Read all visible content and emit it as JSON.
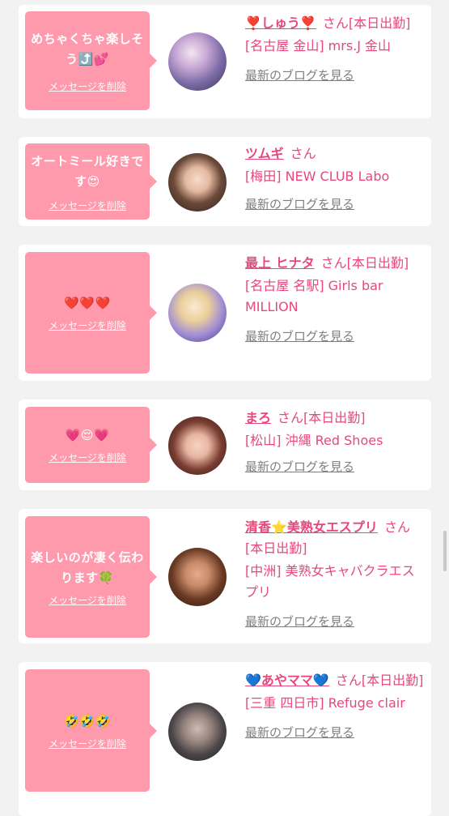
{
  "items": [
    {
      "message": "めちゃくちゃ楽しそう⤴️💕",
      "delete_label": "メッセージを削除",
      "name": "❣️しゅう❣️",
      "san": "さん[本日出勤]",
      "shop": "[名古屋 金山] mrs.J 金山",
      "blog": "最新のブログを見る",
      "avatar_colors": [
        "#7a6aa6",
        "#d9c3d6"
      ]
    },
    {
      "message": "オートミール好きです😍",
      "delete_label": "メッセージを削除",
      "name": "ツムギ",
      "san": "さん",
      "shop": "[梅田] NEW CLUB Labo",
      "blog": "最新のブログを見る",
      "avatar_colors": [
        "#3b2a22",
        "#f0d7c5"
      ]
    },
    {
      "message": "❤️❤️❤️",
      "delete_label": "メッセージを削除",
      "name": "最上 ヒナタ",
      "san": "さん[本日出勤]",
      "shop": "[名古屋 名駅] Girls bar MILLION",
      "blog": "最新のブログを見る",
      "avatar_colors": [
        "#e9d7a6",
        "#8a7ad0"
      ]
    },
    {
      "message": "💗😌💗",
      "delete_label": "メッセージを削除",
      "name": "まろ",
      "san": "さん[本日出勤]",
      "shop": "[松山] 沖縄 Red Shoes",
      "blog": "最新のブログを見る",
      "avatar_colors": [
        "#5a3128",
        "#f2c5b5"
      ]
    },
    {
      "message": "楽しいのが凄く伝わります🍀",
      "delete_label": "メッセージを削除",
      "name": "清香⭐️美熟女エスプリ",
      "san": "さん[本日出勤]",
      "shop": "[中洲] 美熟女キャバクラエスプリ",
      "blog": "最新のブログを見る",
      "avatar_colors": [
        "#6a3a23",
        "#d7a17f"
      ]
    },
    {
      "message": "🤣🤣🤣",
      "delete_label": "メッセージを削除",
      "name": "💙あやママ💙",
      "san": "さん[本日出勤]",
      "shop": "[三重 四日市] Refuge clair",
      "blog": "最新のブログを見る",
      "avatar_colors": [
        "#3f3f45",
        "#b7a9a3"
      ]
    }
  ]
}
